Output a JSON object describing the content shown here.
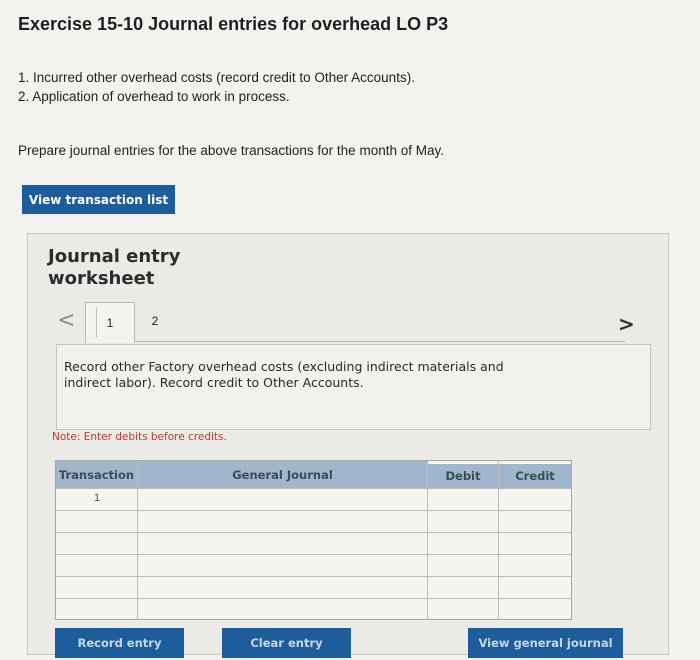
{
  "exercise": {
    "title": "Exercise 15-10 Journal entries for overhead LO P3",
    "items": [
      "1. Incurred other overhead costs (record credit to Other Accounts).",
      "2. Application of overhead to work in process."
    ],
    "instruction": "Prepare journal entries for the above transactions for the month of May."
  },
  "buttons": {
    "view_transaction_list": "View transaction list",
    "record_entry": "Record entry",
    "clear_entry": "Clear entry",
    "view_general_journal": "View general journal"
  },
  "worksheet": {
    "title": "Journal entry worksheet",
    "prev_glyph": "<",
    "next_glyph": ">",
    "tabs": [
      "1",
      "2"
    ],
    "active_tab": "1",
    "description": "Record other Factory overhead costs (excluding indirect materials and indirect labor). Record credit to Other Accounts.",
    "note": "Note: Enter debits before credits."
  },
  "journal": {
    "headers": {
      "transaction": "Transaction",
      "general_journal": "General Journal",
      "debit": "Debit",
      "credit": "Credit"
    },
    "rows": [
      {
        "transaction": "1",
        "account": "",
        "debit": "",
        "credit": ""
      },
      {
        "transaction": "",
        "account": "",
        "debit": "",
        "credit": ""
      },
      {
        "transaction": "",
        "account": "",
        "debit": "",
        "credit": ""
      },
      {
        "transaction": "",
        "account": "",
        "debit": "",
        "credit": ""
      },
      {
        "transaction": "",
        "account": "",
        "debit": "",
        "credit": ""
      },
      {
        "transaction": "",
        "account": "",
        "debit": "",
        "credit": ""
      }
    ]
  },
  "colors": {
    "button_blue": "#1d5d9b",
    "header_blue": "#9fb6cc",
    "note_red": "#c0392b"
  }
}
